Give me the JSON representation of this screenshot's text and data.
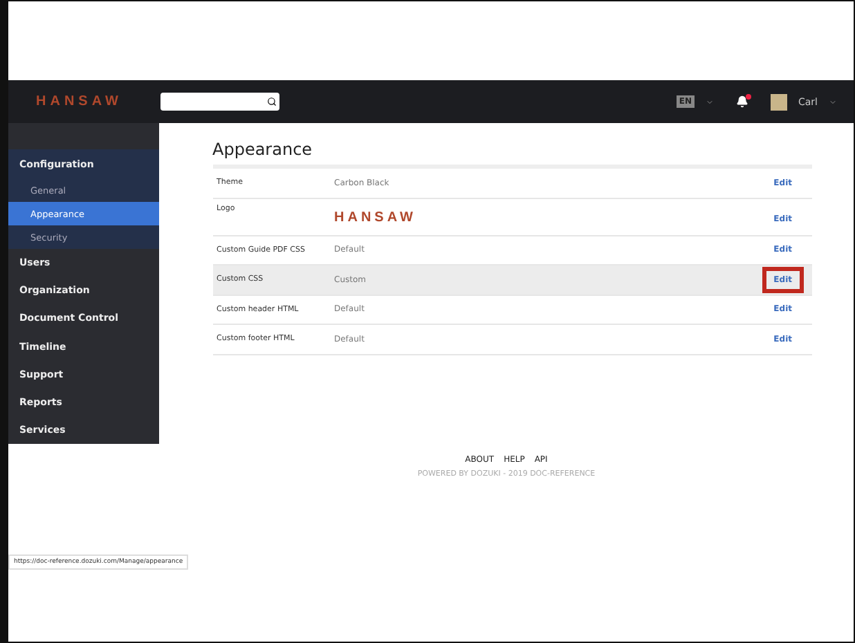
{
  "header": {
    "logo": "HANSAW",
    "language": "EN",
    "notifications": {
      "unread": true
    },
    "user": "Carl"
  },
  "sidebar": {
    "items": [
      {
        "label": "Configuration",
        "expanded": true,
        "selected": false,
        "children": [
          {
            "label": "General",
            "selected": false
          },
          {
            "label": "Appearance",
            "selected": true
          },
          {
            "label": "Security",
            "selected": false
          }
        ]
      },
      {
        "label": "Users",
        "expanded": false,
        "selected": false
      },
      {
        "label": "Organization",
        "expanded": false,
        "selected": false
      },
      {
        "label": "Document Control",
        "expanded": false,
        "selected": false
      },
      {
        "label": "Timeline",
        "expanded": false,
        "selected": false
      },
      {
        "label": "Support",
        "expanded": false,
        "selected": false
      },
      {
        "label": "Reports",
        "expanded": false,
        "selected": false
      },
      {
        "label": "Services",
        "expanded": false,
        "selected": false
      }
    ]
  },
  "page": {
    "title": "Appearance",
    "rows": [
      {
        "label": "Theme",
        "kind": "text",
        "value": "Carbon Black",
        "action": "Edit",
        "highlighted": false,
        "annotated": false
      },
      {
        "label": "Logo",
        "kind": "logo",
        "value": "HANSAW",
        "action": "Edit",
        "highlighted": false,
        "annotated": false
      },
      {
        "label": "Custom Guide PDF CSS",
        "kind": "text",
        "value": "Default",
        "action": "Edit",
        "highlighted": false,
        "annotated": false
      },
      {
        "label": "Custom CSS",
        "kind": "text",
        "value": "Custom",
        "action": "Edit",
        "highlighted": true,
        "annotated": true
      },
      {
        "label": "Custom header HTML",
        "kind": "text",
        "value": "Default",
        "action": "Edit",
        "highlighted": false,
        "annotated": false
      },
      {
        "label": "Custom footer HTML",
        "kind": "text",
        "value": "Default",
        "action": "Edit",
        "highlighted": false,
        "annotated": false
      }
    ]
  },
  "footer": {
    "links": [
      "ABOUT",
      "HELP",
      "API"
    ],
    "powered": "POWERED BY DOZUKI - 2019 DOC-REFERENCE"
  },
  "status_url": "https://doc-reference.dozuki.com/Manage/appearance"
}
